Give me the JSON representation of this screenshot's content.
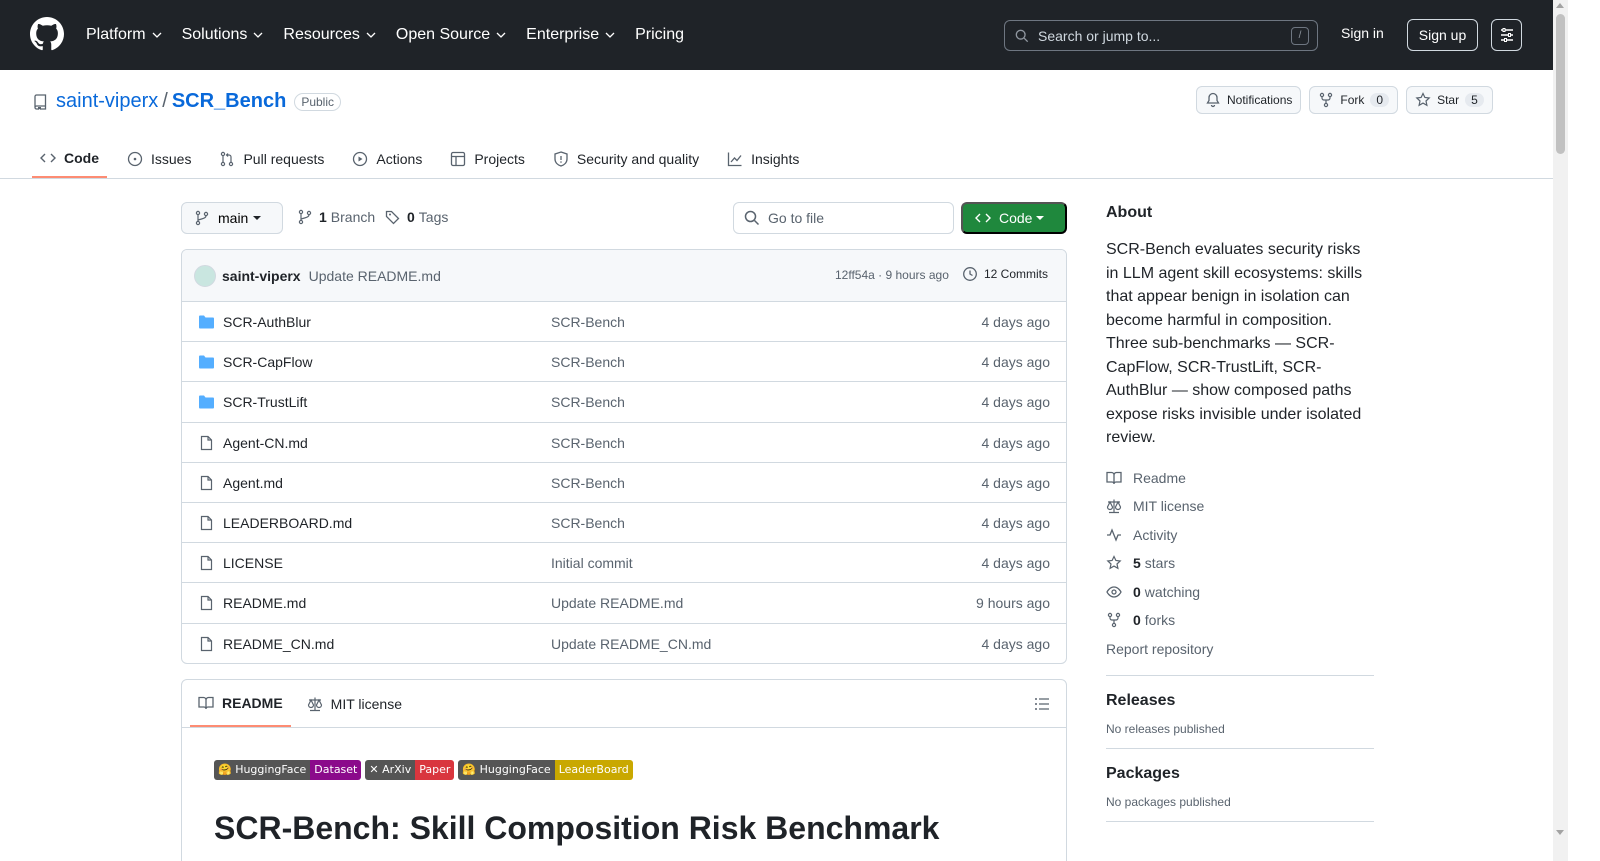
{
  "header": {
    "nav": [
      "Platform",
      "Solutions",
      "Resources",
      "Open Source",
      "Enterprise",
      "Pricing"
    ],
    "search_placeholder": "Search or jump to...",
    "search_shortcut": "/",
    "signin": "Sign in",
    "signup": "Sign up"
  },
  "repo": {
    "owner": "saint-viperx",
    "sep": "/",
    "name": "SCR_Bench",
    "visibility": "Public",
    "notifications": "Notifications",
    "fork_label": "Fork",
    "fork_count": "0",
    "star_label": "Star",
    "star_count": "5"
  },
  "tabs": [
    "Code",
    "Issues",
    "Pull requests",
    "Actions",
    "Projects",
    "Security and quality",
    "Insights"
  ],
  "filenav": {
    "branch": "main",
    "branch_count": "1",
    "branch_label": "Branch",
    "tag_count": "0",
    "tag_label": "Tags",
    "goto_placeholder": "Go to file",
    "code_button": "Code"
  },
  "commit": {
    "author": "saint-viperx",
    "message": "Update README.md",
    "meta": "12ff54a · 9 hours ago",
    "count": "12 Commits"
  },
  "files": [
    {
      "name": "SCR-AuthBlur",
      "type": "dir",
      "commit": "SCR-Bench",
      "date": "4 days ago"
    },
    {
      "name": "SCR-CapFlow",
      "type": "dir",
      "commit": "SCR-Bench",
      "date": "4 days ago"
    },
    {
      "name": "SCR-TrustLift",
      "type": "dir",
      "commit": "SCR-Bench",
      "date": "4 days ago"
    },
    {
      "name": "Agent-CN.md",
      "type": "file",
      "commit": "SCR-Bench",
      "date": "4 days ago"
    },
    {
      "name": "Agent.md",
      "type": "file",
      "commit": "SCR-Bench",
      "date": "4 days ago"
    },
    {
      "name": "LEADERBOARD.md",
      "type": "file",
      "commit": "SCR-Bench",
      "date": "4 days ago"
    },
    {
      "name": "LICENSE",
      "type": "file",
      "commit": "Initial commit",
      "date": "4 days ago"
    },
    {
      "name": "README.md",
      "type": "file",
      "commit": "Update README.md",
      "date": "9 hours ago"
    },
    {
      "name": "README_CN.md",
      "type": "file",
      "commit": "Update README_CN.md",
      "date": "4 days ago"
    }
  ],
  "readme": {
    "tab_readme": "README",
    "tab_license": "MIT license",
    "badges": [
      {
        "left": "🤗 HuggingFace",
        "right": "Dataset",
        "color": "#8b0a8b"
      },
      {
        "left": "✕ ArXiv",
        "right": "Paper",
        "color": "#d9363e"
      },
      {
        "left": "🤗 HuggingFace",
        "right": "LeaderBoard",
        "color": "#c9a800"
      }
    ],
    "title": "SCR-Bench: Skill Composition Risk Benchmark"
  },
  "about": {
    "heading": "About",
    "description": "SCR-Bench evaluates security risks in LLM agent skill ecosystems: skills that appear benign in isolation can become harmful in composition. Three sub-benchmarks — SCR-CapFlow, SCR-TrustLift, SCR-AuthBlur — show composed paths expose risks invisible under isolated review.",
    "readme": "Readme",
    "license": "MIT license",
    "activity": "Activity",
    "stars_count": "5",
    "stars_label": "stars",
    "watching_count": "0",
    "watching_label": "watching",
    "forks_count": "0",
    "forks_label": "forks",
    "report": "Report repository"
  },
  "releases": {
    "heading": "Releases",
    "empty": "No releases published"
  },
  "packages": {
    "heading": "Packages",
    "empty": "No packages published"
  }
}
